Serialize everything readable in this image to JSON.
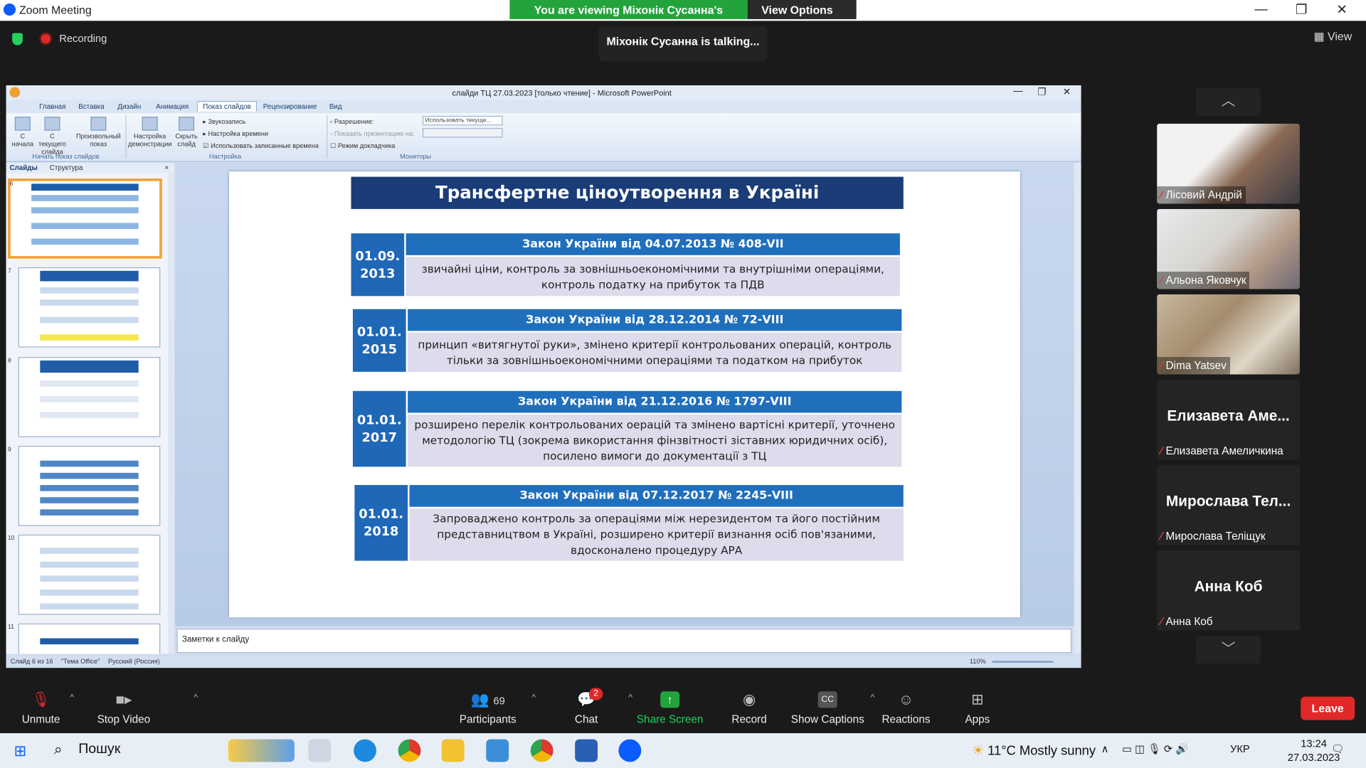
{
  "zoom": {
    "window_title": "Zoom Meeting",
    "viewing_banner": "You are viewing Міхонік Сусанна's screen",
    "view_options": "View Options",
    "recording": "Recording",
    "talking": "Міхонік Сусанна is talking...",
    "view_label": "View"
  },
  "ppt": {
    "title": "слайди ТЦ 27.03.2023 [только чтение] - Microsoft PowerPoint",
    "tabs": [
      "Главная",
      "Вставка",
      "Дизайн",
      "Анимация",
      "Показ слайдов",
      "Рецензирование",
      "Вид"
    ],
    "ribbon": {
      "from_start": "С начала",
      "from_current": "С текущего слайда",
      "custom_show": "Произвольный показ",
      "setup_show": "Настройка демонстрации",
      "hide_slide": "Скрыть слайд",
      "record_narration": "Звукозапись",
      "rehearse_timings": "Настройка времени",
      "use_timings": "Использовать записанные времена",
      "group_start": "Начать показ слайдов",
      "group_setup": "Настройка",
      "resolution_label": "Разрешение:",
      "resolution_value": "Использовать текуще...",
      "show_on_label": "Показать презентацию на:",
      "presenter_view": "Режим докладчика",
      "group_monitors": "Мониторы"
    },
    "side_tabs": [
      "Слайды",
      "Структура"
    ],
    "thumb_numbers": [
      "6",
      "7",
      "8",
      "9",
      "10",
      "11"
    ],
    "notes_placeholder": "Заметки к слайду",
    "status": {
      "slide": "Слайд 6 из 16",
      "theme": "\"Тема Office\"",
      "lang": "Русский (Россия)",
      "zoom": "110%"
    }
  },
  "slide": {
    "title": "Трансфертне ціноутворення в Україні",
    "laws": [
      {
        "date": "01.09. 2013",
        "head": "Закон України від 04.07.2013  № 408-VII",
        "body": "звичайні ціни, контроль за зовнішньоекономічними та внутрішніми операціями, контроль податку на прибуток та ПДВ"
      },
      {
        "date": "01.01. 2015",
        "head": "Закон України від 28.12.2014 № 72-VIII",
        "body": "принцип «витягнутої руки», змінено критерії контрольованих операцій, контроль тільки за зовнішньоекономічними операціями та податком на прибуток"
      },
      {
        "date": "01.01. 2017",
        "head": "Закон України від 21.12.2016 № 1797-VIII",
        "body": "розширено перелік контрольованих оерацій  та змінено вартісні критерії, уточнено методологію ТЦ (зокрема використання фінзвітності зіставних юридичних осіб), посилено вимоги до документації з ТЦ"
      },
      {
        "date": "01.01. 2018",
        "head": "Закон України від 07.12.2017 № 2245-VIII",
        "body": "Запроваджено контроль за операціями між нерезидентом та його постійним представництвом в Україні, розширено критерії визнання осіб пов'язаними, вдосконалено процедуру АРА"
      }
    ]
  },
  "participants": [
    {
      "name": "Лісовий Андрій",
      "video": true
    },
    {
      "name": "Альона Яковчук",
      "video": true
    },
    {
      "name": "Dima Yatsev",
      "video": true
    },
    {
      "name": "Елизавета Амелич",
      "big": "Елизавета  Аме...",
      "video": false,
      "full": "Елизавета Амеличкина"
    },
    {
      "name": "Мирослава Тел",
      "big": "Мирослава  Тел...",
      "video": false,
      "full": "Мирослава Теліщук"
    },
    {
      "name": "Анна Коб",
      "big": "Анна Коб",
      "video": false,
      "full": "Анна Коб"
    }
  ],
  "toolbar": {
    "unmute": "Unmute",
    "stop_video": "Stop Video",
    "participants": "Participants",
    "participants_count": "69",
    "chat": "Chat",
    "chat_badge": "2",
    "share": "Share Screen",
    "record": "Record",
    "captions": "Show Captions",
    "reactions": "Reactions",
    "apps": "Apps",
    "leave": "Leave"
  },
  "taskbar": {
    "search": "Пошук",
    "weather": "11°C  Mostly sunny",
    "lang": "УКР",
    "time": "13:24",
    "date": "27.03.2023"
  },
  "colors": {
    "zoom_green": "#23a33c",
    "leave_red": "#e02828",
    "slide_title_bg": "#1a3c78",
    "law_blue": "#1f6fbd"
  }
}
